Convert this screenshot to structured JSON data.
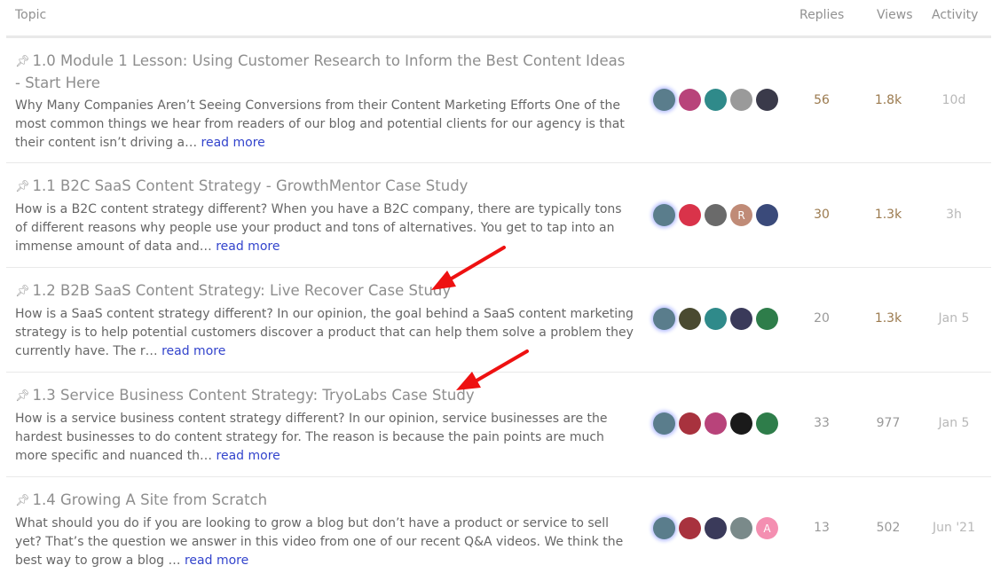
{
  "header": {
    "topic": "Topic",
    "replies": "Replies",
    "views": "Views",
    "activity": "Activity"
  },
  "topics": [
    {
      "pin_icon": "pin-icon",
      "title": "1.0 Module 1 Lesson: Using Customer Research to Inform the Best Content Ideas - Start Here",
      "excerpt": "Why Many Companies Aren’t Seeing Conversions from their Content Marketing Efforts One of the most common things we hear from readers of our blog and potential clients for our agency is that their content isn’t driving a…",
      "read_more": "read more",
      "posters": [
        {
          "initial": "",
          "color": "#5a7d8c"
        },
        {
          "initial": "",
          "color": "#b8437a"
        },
        {
          "initial": "",
          "color": "#2f8a8a"
        },
        {
          "initial": "",
          "color": "#9a9a9a"
        },
        {
          "initial": "",
          "color": "#3a3a4a"
        }
      ],
      "replies": "56",
      "views": "1.8k",
      "activity": "10d",
      "replies_color": "#9b7a4e",
      "views_color": "#9b7a4e"
    },
    {
      "pin_icon": "pin-icon",
      "title": "1.1 B2C SaaS Content Strategy - GrowthMentor Case Study",
      "excerpt": "How is a B2C content strategy different? When you have a B2C company, there are typically tons of different reasons why people use your product and tons of alternatives. You get to tap into an immense amount of data and…",
      "read_more": "read more",
      "posters": [
        {
          "initial": "",
          "color": "#5a7d8c"
        },
        {
          "initial": "",
          "color": "#d9334a"
        },
        {
          "initial": "",
          "color": "#6a6a6a"
        },
        {
          "initial": "R",
          "color": "#c08b77"
        },
        {
          "initial": "",
          "color": "#3a4a7a"
        }
      ],
      "replies": "30",
      "views": "1.3k",
      "activity": "3h",
      "replies_color": "#9b7a4e",
      "views_color": "#9b7a4e"
    },
    {
      "pin_icon": "pin-icon",
      "title": "1.2 B2B SaaS Content Strategy: Live Recover Case Study",
      "excerpt": "How is a SaaS content strategy different? In our opinion, the goal behind a SaaS content marketing strategy is to help potential customers discover a product that can help them solve a problem they currently have. The r…",
      "read_more": "read more",
      "posters": [
        {
          "initial": "",
          "color": "#5a7d8c"
        },
        {
          "initial": "",
          "color": "#4a4a30"
        },
        {
          "initial": "",
          "color": "#2f8a8a"
        },
        {
          "initial": "",
          "color": "#3a3a5a"
        },
        {
          "initial": "",
          "color": "#2e7d4a"
        }
      ],
      "replies": "20",
      "views": "1.3k",
      "activity": "Jan 5",
      "replies_color": "#999999",
      "views_color": "#9b7a4e"
    },
    {
      "pin_icon": "pin-icon",
      "title": "1.3 Service Business Content Strategy: TryoLabs Case Study",
      "excerpt": "How is a service business content strategy different? In our opinion, service businesses are the hardest businesses to do content strategy for. The reason is because the pain points are much more specific and nuanced th…",
      "read_more": "read more",
      "posters": [
        {
          "initial": "",
          "color": "#5a7d8c"
        },
        {
          "initial": "",
          "color": "#a8323e"
        },
        {
          "initial": "",
          "color": "#b8437a"
        },
        {
          "initial": "",
          "color": "#1a1a1a"
        },
        {
          "initial": "",
          "color": "#2e7d4a"
        }
      ],
      "replies": "33",
      "views": "977",
      "activity": "Jan 5",
      "replies_color": "#999999",
      "views_color": "#999999"
    },
    {
      "pin_icon": "pin-icon",
      "title": "1.4 Growing A Site from Scratch",
      "excerpt": "What should you do if you are looking to grow a blog but don’t have a product or service to sell yet? That’s the question we answer in this video from one of our recent Q&A videos. We think the best way to grow a blog …",
      "read_more": "read more",
      "posters": [
        {
          "initial": "",
          "color": "#5a7d8c"
        },
        {
          "initial": "",
          "color": "#a8323e"
        },
        {
          "initial": "",
          "color": "#3a3a5a"
        },
        {
          "initial": "",
          "color": "#7a8a8a"
        },
        {
          "initial": "A",
          "color": "#f48fb1"
        }
      ],
      "replies": "13",
      "views": "502",
      "activity": "Jun '21",
      "replies_color": "#999999",
      "views_color": "#999999"
    }
  ],
  "annotations": {
    "arrow_color": "#ee1111"
  }
}
